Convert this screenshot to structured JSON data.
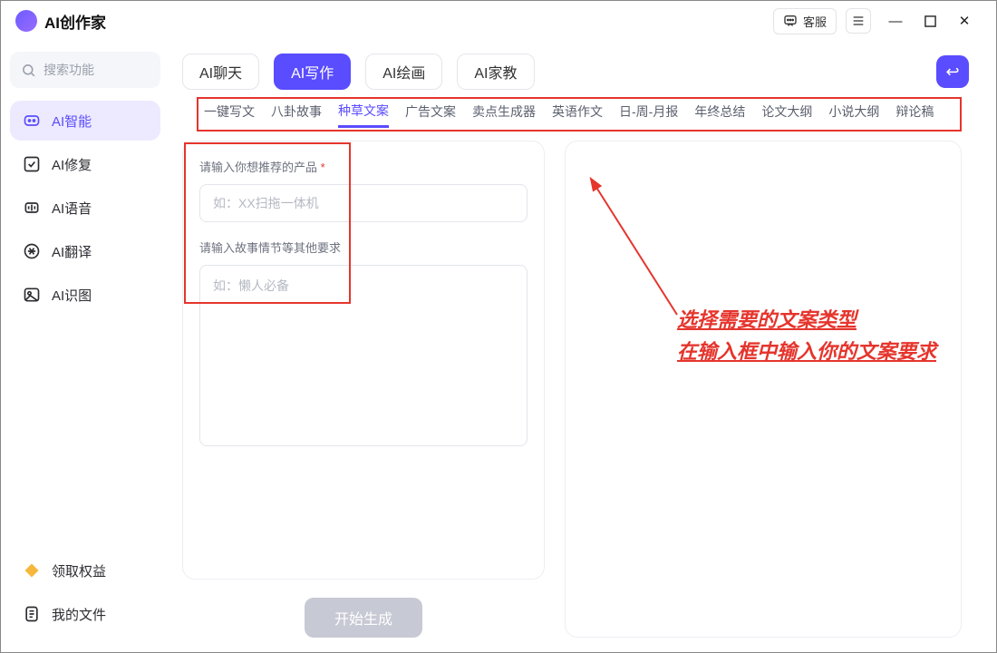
{
  "app": {
    "title": "AI创作家"
  },
  "titlebar": {
    "service_label": "客服"
  },
  "search": {
    "placeholder": "搜索功能"
  },
  "sidebar": {
    "items": [
      {
        "label": "AI智能",
        "icon": "ai-icon",
        "active": true
      },
      {
        "label": "AI修复",
        "icon": "repair-icon"
      },
      {
        "label": "AI语音",
        "icon": "voice-icon"
      },
      {
        "label": "AI翻译",
        "icon": "translate-icon"
      },
      {
        "label": "AI识图",
        "icon": "image-icon"
      }
    ],
    "bottom": [
      {
        "label": "领取权益",
        "icon": "benefit-icon"
      },
      {
        "label": "我的文件",
        "icon": "file-icon"
      }
    ]
  },
  "top_tabs": {
    "items": [
      {
        "label": "AI聊天"
      },
      {
        "label": "AI写作",
        "active": true
      },
      {
        "label": "AI绘画"
      },
      {
        "label": "AI家教"
      }
    ]
  },
  "sub_tabs": {
    "items": [
      {
        "label": "一键写文"
      },
      {
        "label": "八卦故事"
      },
      {
        "label": "种草文案",
        "active": true
      },
      {
        "label": "广告文案"
      },
      {
        "label": "卖点生成器"
      },
      {
        "label": "英语作文"
      },
      {
        "label": "日-周-月报"
      },
      {
        "label": "年终总结"
      },
      {
        "label": "论文大纲"
      },
      {
        "label": "小说大纲"
      },
      {
        "label": "辩论稿"
      }
    ]
  },
  "form": {
    "product_label": "请输入你想推荐的产品",
    "product_placeholder": "如：XX扫拖一体机",
    "detail_label": "请输入故事情节等其他要求",
    "detail_placeholder": "如：懒人必备",
    "generate_label": "开始生成"
  },
  "annotation": {
    "line1": "选择需要的文案类型",
    "line2": "在输入框中输入你的文案要求"
  },
  "colors": {
    "accent": "#5a4cff",
    "highlight": "#e5352d"
  }
}
